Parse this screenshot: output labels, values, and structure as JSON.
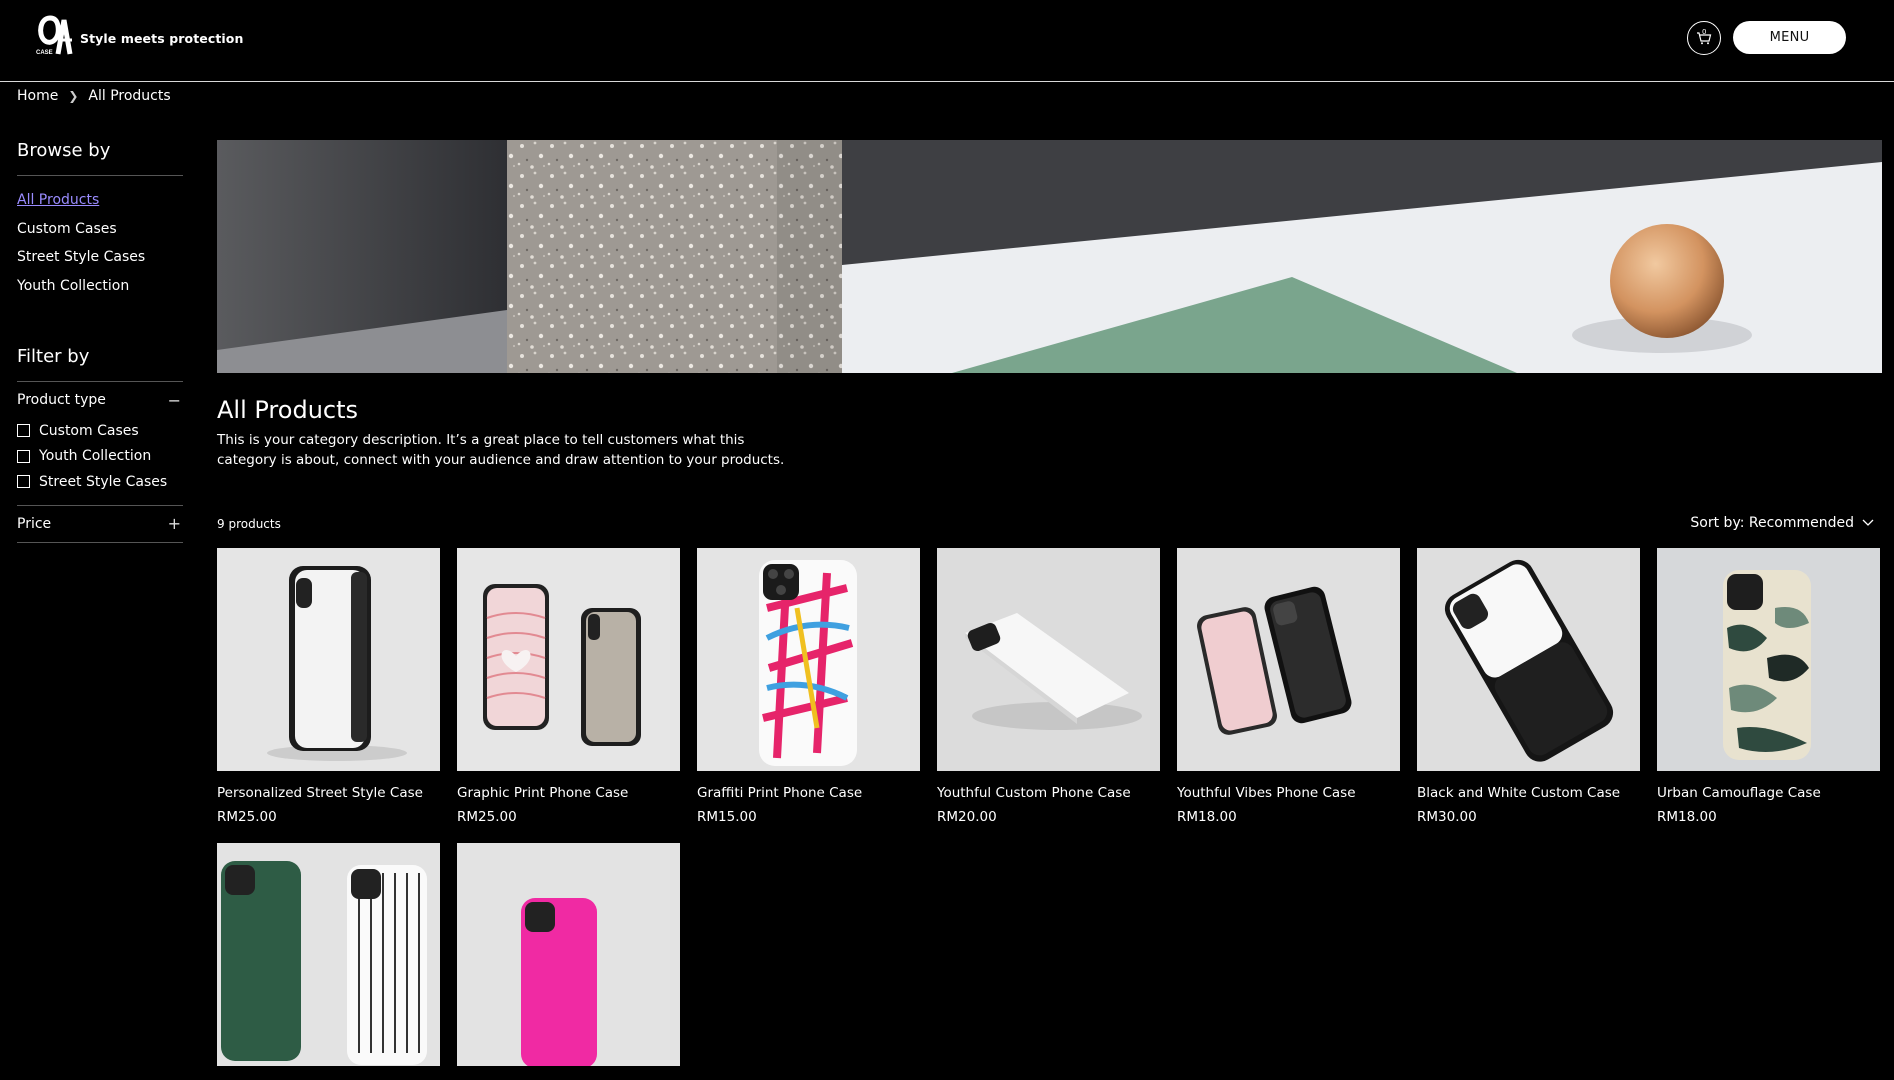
{
  "header": {
    "brand_mark": "CASE",
    "tagline": "Style meets protection",
    "cart_count": "0",
    "menu_label": "MENU"
  },
  "breadcrumb": {
    "home": "Home",
    "current": "All Products"
  },
  "sidebar": {
    "browse_title": "Browse by",
    "categories": [
      "All Products",
      "Custom Cases",
      "Street Style Cases",
      "Youth Collection"
    ],
    "filter_title": "Filter by",
    "product_type_label": "Product type",
    "product_types": [
      "Custom Cases",
      "Youth Collection",
      "Street Style Cases"
    ],
    "price_label": "Price"
  },
  "category": {
    "title": "All Products",
    "description": "This is your category description. It’s a great place to tell customers what this category is about, connect with your audience and draw attention to your products."
  },
  "listing": {
    "count": "9 products",
    "sort_label": "Sort by: Recommended",
    "products": [
      {
        "name": "Personalized Street Style Case",
        "price": "RM25.00"
      },
      {
        "name": "Graphic Print Phone Case",
        "price": "RM25.00"
      },
      {
        "name": "Graffiti Print Phone Case",
        "price": "RM15.00"
      },
      {
        "name": "Youthful Custom Phone Case",
        "price": "RM20.00"
      },
      {
        "name": "Youthful Vibes Phone Case",
        "price": "RM18.00"
      },
      {
        "name": "Black and White Custom Case",
        "price": "RM30.00"
      },
      {
        "name": "Urban Camouflage Case",
        "price": "RM18.00"
      },
      {
        "name": "",
        "price": ""
      },
      {
        "name": "",
        "price": ""
      }
    ]
  },
  "colors": {
    "accent_link": "#9a8cff",
    "background": "#000000",
    "text": "#ffffff"
  }
}
